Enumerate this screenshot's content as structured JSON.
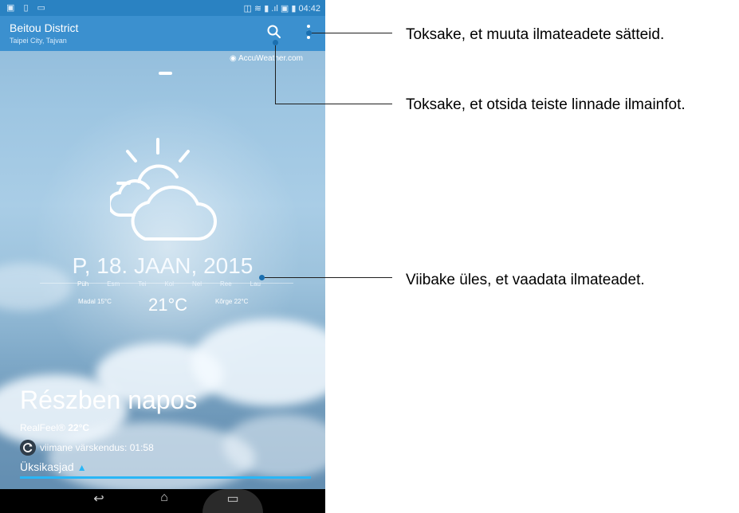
{
  "status_bar": {
    "left_icons": "▣ ▯ ▭",
    "right_text": "◫ ≋ ▮ .ıl ▣ ▮ 04:42"
  },
  "header": {
    "location": "Beitou District",
    "sublocation": "Taipei City, Tajvan"
  },
  "accuweather": "AccuWeather.com",
  "forecast": {
    "date": "P, 18. JAAN, 2015",
    "days": [
      "Püh",
      "Esm",
      "Tei",
      "Kol",
      "Nel",
      "Ree",
      "Lau"
    ],
    "low": "Madal 15°C",
    "high": "Kõrge 22°C",
    "current_temp": "21°C"
  },
  "current": {
    "condition": "Részben napos",
    "realfeel_label": "RealFeel®",
    "realfeel_value": "22°C",
    "last_updated": "viimane värskendus: 01:58",
    "details_label": "Üksikasjad"
  },
  "nav": {
    "back": "↩",
    "home": "⌂",
    "recents": "▭"
  },
  "annotations": {
    "settings": "Toksake, et muuta ilmateadete sätteid.",
    "search": "Toksake, et otsida teiste linnade ilmainfot.",
    "swipe": "Viibake üles, et vaadata ilmateadet."
  },
  "icons": [
    "search-icon",
    "more-vert-icon",
    "partly-sunny-icon",
    "refresh-icon",
    "accuweather-logo-icon"
  ],
  "colors": {
    "header": "#3b90cf",
    "statusbar": "#2a82c2",
    "accent": "#29b6f6",
    "pointer": "#1a6fb0"
  }
}
